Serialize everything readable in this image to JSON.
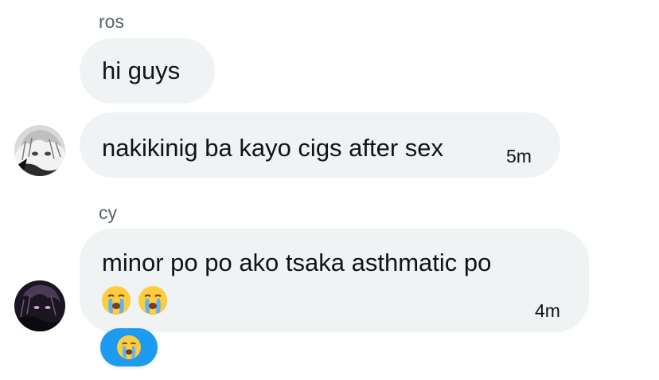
{
  "messages": [
    {
      "sender": "ros",
      "bubbles": [
        {
          "text": "hi guys",
          "time": ""
        },
        {
          "text": "nakikinig ba kayo cigs after sex",
          "time": "5m"
        }
      ],
      "avatar": "anime-avatar-grayscale"
    },
    {
      "sender": "cy",
      "bubbles": [
        {
          "text": "minor po po ako tsaka asthmatic po",
          "emojis": [
            "crying-face",
            "crying-face"
          ],
          "time": "4m"
        }
      ],
      "avatar": "anime-avatar-dark",
      "reaction": {
        "emoji": "crying-face",
        "color": "#1d9bf0"
      }
    }
  ],
  "colors": {
    "bubble_bg": "#eff3f4",
    "sender_name": "#536471",
    "text": "#0f1419",
    "reaction_bg": "#1d9bf0"
  }
}
